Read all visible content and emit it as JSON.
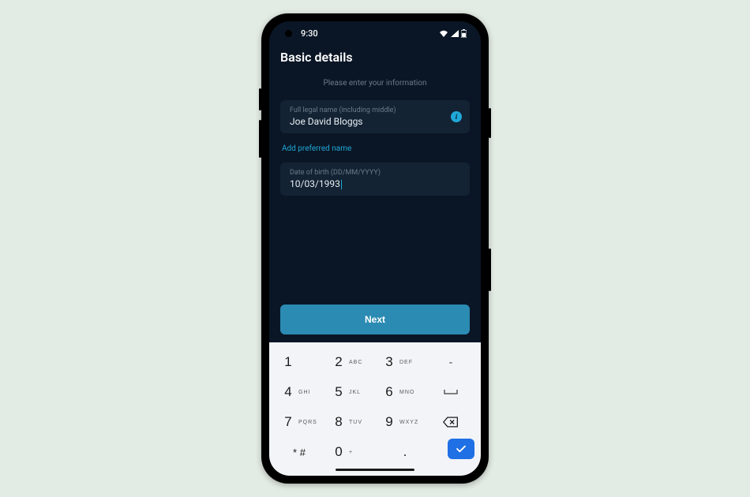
{
  "status": {
    "time": "9:30"
  },
  "header": {
    "title": "Basic details",
    "subtitle": "Please enter your information"
  },
  "fields": {
    "legal_name": {
      "label": "Full legal name (including middle)",
      "value": "Joe David Bloggs"
    },
    "preferred_link": "Add preferred name",
    "dob": {
      "label": "Date of birth (DD/MM/YYYY)",
      "value": "10/03/1993"
    }
  },
  "actions": {
    "next": "Next"
  },
  "keypad": {
    "r1": [
      {
        "d": "1",
        "l": ""
      },
      {
        "d": "2",
        "l": "ABC"
      },
      {
        "d": "3",
        "l": "DEF"
      },
      {
        "sym": "-"
      }
    ],
    "r2": [
      {
        "d": "4",
        "l": "GHI"
      },
      {
        "d": "5",
        "l": "JKL"
      },
      {
        "d": "6",
        "l": "MNO"
      }
    ],
    "r3": [
      {
        "d": "7",
        "l": "PQRS"
      },
      {
        "d": "8",
        "l": "TUV"
      },
      {
        "d": "9",
        "l": "WXYZ"
      }
    ],
    "r4": [
      {
        "d": "* #",
        "l": ""
      },
      {
        "d": "0",
        "l": "+"
      },
      {
        "d": ".",
        "l": ""
      }
    ]
  }
}
